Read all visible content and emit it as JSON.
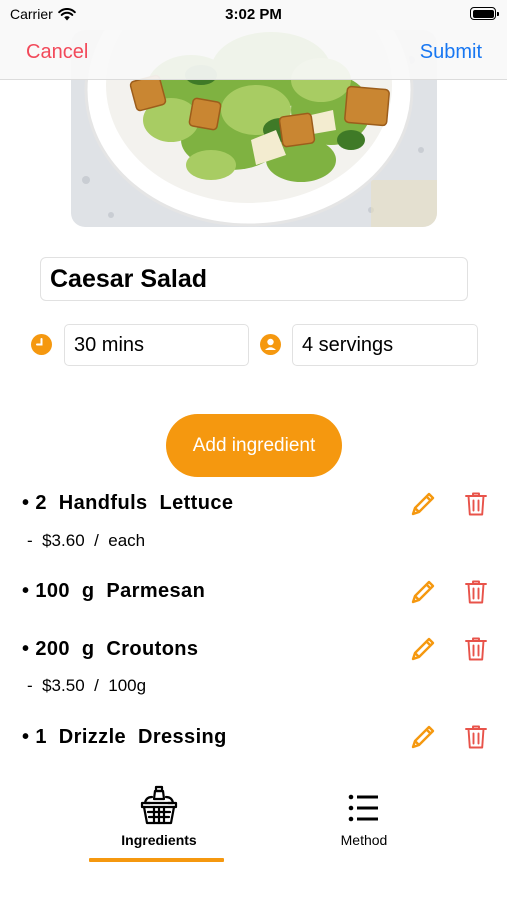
{
  "status_bar": {
    "carrier": "Carrier",
    "time": "3:02 PM"
  },
  "nav": {
    "cancel_label": "Cancel",
    "submit_label": "Submit"
  },
  "recipe": {
    "title": "Caesar Salad",
    "time": "30 mins",
    "servings": "4 servings"
  },
  "add_ingredient_label": "Add ingredient",
  "ingredients": [
    {
      "line": "2  Handfuls  Lettuce",
      "price": "-  $3.60  /  each"
    },
    {
      "line": "100  g  Parmesan",
      "price": ""
    },
    {
      "line": "200  g  Croutons",
      "price": "-  $3.50  /  100g"
    },
    {
      "line": "1  Drizzle  Dressing",
      "price": ""
    }
  ],
  "tabs": [
    {
      "label": "Ingredients",
      "active": true,
      "icon": "basket-icon"
    },
    {
      "label": "Method",
      "active": false,
      "icon": "list-icon"
    }
  ],
  "colors": {
    "accent": "#f5980f",
    "cancel": "#f2495a",
    "submit": "#1877f2",
    "delete": "#e8534a"
  }
}
